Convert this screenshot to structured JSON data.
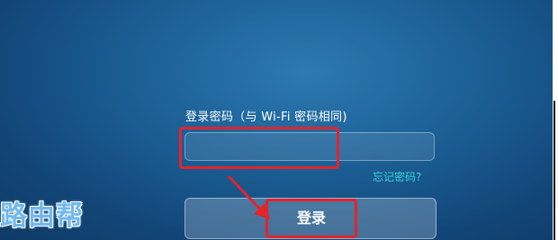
{
  "login": {
    "password_label": "登录密码（与 Wi-Fi 密码相同)",
    "password_value": "",
    "forgot_link": "忘记密码?",
    "login_button": "登录"
  },
  "watermark": {
    "text": "路由帮"
  },
  "colors": {
    "highlight": "#e4232b",
    "link": "#36d3de",
    "background": "#1b5f95"
  }
}
